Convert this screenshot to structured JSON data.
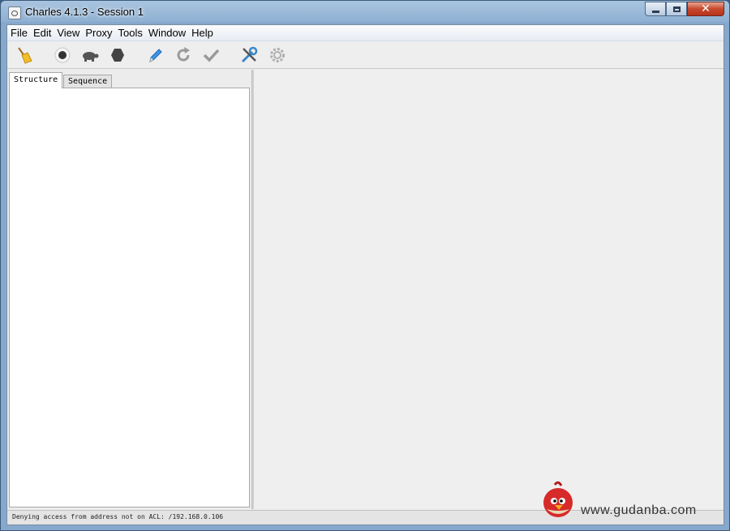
{
  "window": {
    "title": "Charles 4.1.3 - Session 1",
    "app_icon": "charles-jar-icon",
    "controls": [
      "minimize-icon",
      "maximize-icon",
      "close-icon"
    ]
  },
  "menubar": {
    "items": [
      "File",
      "Edit",
      "View",
      "Proxy",
      "Tools",
      "Window",
      "Help"
    ]
  },
  "toolbar": {
    "buttons": [
      {
        "icon": "broom-icon",
        "color": "#e8b21a"
      },
      {
        "icon": "record-icon",
        "color": "#333333"
      },
      {
        "icon": "turtle-icon",
        "color": "#555555"
      },
      {
        "icon": "stop-hexagon-icon",
        "color": "#444444"
      },
      {
        "icon": "pencil-icon",
        "color": "#2f8be0"
      },
      {
        "icon": "refresh-icon",
        "color": "#9a9a9a"
      },
      {
        "icon": "checkmark-icon",
        "color": "#9a9a9a"
      },
      {
        "icon": "tools-icon",
        "color": "#3a86c8"
      },
      {
        "icon": "settings-gear-icon",
        "color": "#b0b0b0"
      }
    ]
  },
  "tabs": {
    "structure": "Structure",
    "sequence": "Sequence"
  },
  "status": {
    "message": "Denying access from address not on ACL: /192.168.0.106"
  },
  "watermark": {
    "text": "www.gudanba.com",
    "logo": "angry-bird-icon"
  }
}
